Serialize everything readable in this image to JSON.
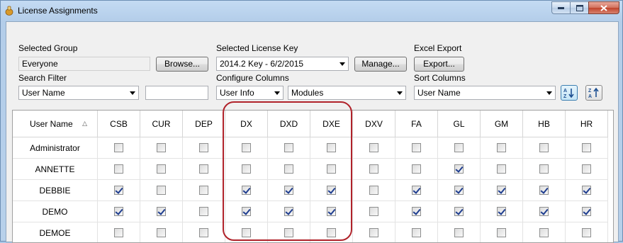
{
  "window": {
    "title": "License Assignments"
  },
  "filters": {
    "selected_group_label": "Selected Group",
    "selected_group_value": "Everyone",
    "browse_button": "Browse...",
    "license_key_label": "Selected License Key",
    "license_key_value": "2014.2 Key - 6/2/2015",
    "manage_button": "Manage...",
    "excel_export_label": "Excel Export",
    "export_button": "Export...",
    "search_filter_label": "Search Filter",
    "search_filter_value": "User Name",
    "search_text_value": "",
    "configure_columns_label": "Configure Columns",
    "configure_columns_value1": "User Info",
    "configure_columns_value2": "Modules",
    "sort_columns_label": "Sort Columns",
    "sort_columns_value": "User Name"
  },
  "grid": {
    "columns": [
      "User Name",
      "CSB",
      "CUR",
      "DEP",
      "DX",
      "DXD",
      "DXE",
      "DXV",
      "FA",
      "GL",
      "GM",
      "HB",
      "HR"
    ],
    "rows": [
      {
        "user": "Administrator",
        "checks": [
          false,
          false,
          false,
          false,
          false,
          false,
          false,
          false,
          false,
          false,
          false,
          false
        ]
      },
      {
        "user": "ANNETTE",
        "checks": [
          false,
          false,
          false,
          false,
          false,
          false,
          false,
          false,
          true,
          false,
          false,
          false
        ]
      },
      {
        "user": "DEBBIE",
        "checks": [
          true,
          false,
          false,
          true,
          true,
          true,
          false,
          true,
          true,
          true,
          true,
          true
        ]
      },
      {
        "user": "DEMO",
        "checks": [
          true,
          true,
          false,
          true,
          true,
          true,
          false,
          true,
          true,
          true,
          true,
          true
        ]
      },
      {
        "user": "DEMOE",
        "checks": [
          false,
          false,
          false,
          false,
          false,
          false,
          false,
          false,
          false,
          false,
          false,
          false
        ]
      }
    ]
  }
}
